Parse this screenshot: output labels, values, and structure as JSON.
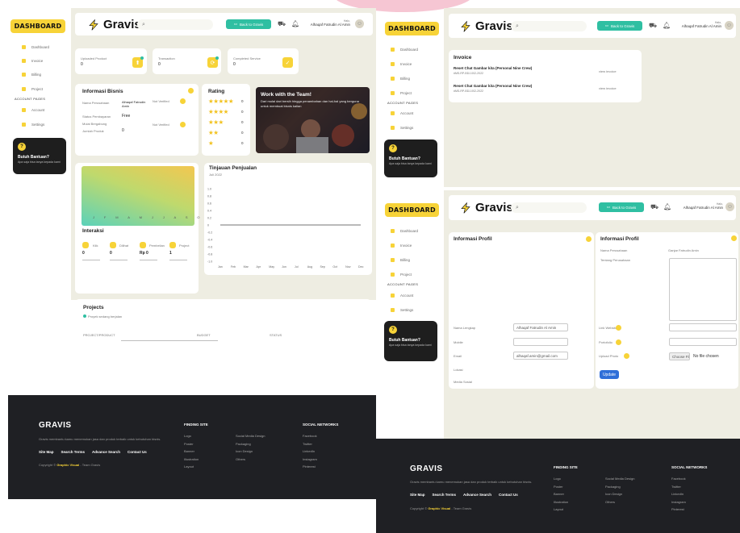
{
  "brand": {
    "sidebar_logo": "DASHBOARD",
    "app_name": "Gravis"
  },
  "colors": {
    "accent_yellow": "#f7d338",
    "accent_teal": "#2fbfa2",
    "panel_bg": "#eeede2",
    "footer_bg": "#1f2024"
  },
  "topbar": {
    "search_icon": "search-icon",
    "back_button": "Back to Gravis",
    "user_small": "Halo,",
    "user_name": "Alhaqaf Fatrudin Al Amin"
  },
  "sidebar": {
    "items": [
      {
        "label": "Dashboard",
        "icon": "home-icon",
        "color": "#f7d338"
      },
      {
        "label": "Invoice",
        "icon": "invoice-icon",
        "color": "#f7d338"
      },
      {
        "label": "Billing",
        "icon": "billing-icon",
        "color": "#f7d338"
      },
      {
        "label": "Project",
        "icon": "project-icon",
        "color": "#f7d338"
      }
    ],
    "section": "ACCOUNT PAGES",
    "account_items": [
      {
        "label": "Account",
        "icon": "user-icon",
        "color": "#f7d338"
      },
      {
        "label": "Settings",
        "icon": "settings-icon",
        "color": "#f7d338"
      }
    ],
    "help_title": "Butuh Bantuan?",
    "help_sub": "Apa saja bisa tanya kepada kami",
    "help_icon": "?"
  },
  "dashboard": {
    "stats": [
      {
        "label": "Uploaded Product",
        "value": "0"
      },
      {
        "label": "Transaction",
        "value": "0"
      },
      {
        "label": "Completed Service",
        "value": "0"
      }
    ],
    "info_title": "Informasi Bisnis",
    "info_rows": [
      {
        "label": "Nama Perusahaan",
        "value": "Alhaqaf Fatrudin Amin"
      },
      {
        "label": "Status Pembayaran",
        "value": "Free"
      },
      {
        "label": "Mulai Bergabung",
        "value": ""
      },
      {
        "label": "Jumlah Produk",
        "value": "0"
      }
    ],
    "info_right": [
      "Not Verified",
      "Not Verified"
    ],
    "rating_title": "Rating",
    "ratings": [
      {
        "stars": "★★★★★",
        "count": "0"
      },
      {
        "stars": "★★★★",
        "count": "0"
      },
      {
        "stars": "★★★",
        "count": "0"
      },
      {
        "stars": "★★",
        "count": "0"
      },
      {
        "stars": "★",
        "count": "0"
      }
    ],
    "team_title": "Work with the Team!",
    "team_text": "Dari mulai dari bersih hingga penambahan dan hal-hal yang berguna untuk membuat bisnis kalian",
    "months": "J F M A M J J A S O N D",
    "interaksi_title": "Interaksi",
    "interaksi": [
      {
        "label": "Klik",
        "value": "0"
      },
      {
        "label": "Dilihat",
        "value": "0"
      },
      {
        "label": "Pembelian",
        "value": "Rp 0"
      },
      {
        "label": "Project",
        "value": "1"
      }
    ],
    "sales_title": "Tinjauan Penjualan",
    "sales_sub": "Juli 2022",
    "projects_title": "Projects",
    "projects_sub": "Proyek sedang berjalan",
    "projects_cols": [
      "PROJECT/PRODUCT",
      "BUDGET",
      "STATUS"
    ]
  },
  "chart_data": {
    "type": "line",
    "title": "Tinjauan Penjualan",
    "categories": [
      "Jan",
      "Feb",
      "Mar",
      "Apr",
      "May",
      "Jun",
      "Jul",
      "Aug",
      "Sep",
      "Oct",
      "Nov",
      "Dec"
    ],
    "series": [
      {
        "values": [
          0,
          0,
          0,
          0,
          0,
          0,
          0,
          0,
          0,
          0,
          0,
          0
        ]
      }
    ],
    "yticks": [
      "1.0",
      "0.8",
      "0.6",
      "0.4",
      "0.2",
      "0",
      "-0.2",
      "-0.4",
      "-0.6",
      "-0.8",
      "-1.0"
    ],
    "ylim": [
      -1,
      1
    ],
    "grid": false
  },
  "invoice": {
    "title": "Invoice",
    "items": [
      {
        "name": "Reset Chat Gambar kita (Personal Nine Crew)",
        "code": "#MS-RP-BDJ-002-2022",
        "action": "view invoice"
      },
      {
        "name": "Reset Chat Gambar kita (Personal Nine Crew)",
        "code": "#MS-RP-BDJ-002-2022",
        "action": "view invoice"
      }
    ]
  },
  "profile": {
    "left_title": "Informasi Profil",
    "right_title": "Informasi Profil",
    "right_name_label": "Nama Perusahaan",
    "right_name_value": "Ganjar Fatrudin Amin",
    "right_about_label": "Tentang Perusahaan",
    "fields": [
      {
        "label": "Nama Lengkap",
        "value": "Alhaqaf Fatrudin Al Amin"
      },
      {
        "label": "Mobile",
        "value": ""
      },
      {
        "label": "Email",
        "value": "alhaqaf.amin@gmail.com"
      },
      {
        "label": "Lokasi",
        "value": ""
      },
      {
        "label": "Media Sosial",
        "value": ""
      }
    ],
    "right_fields": [
      {
        "label": "Link Website",
        "value": ""
      },
      {
        "label": "Portofolio",
        "value": ""
      },
      {
        "label": "Upload Photo",
        "value": ""
      }
    ],
    "choose_file": "Choose File",
    "no_file": "No file chosen",
    "update_button": "Update"
  },
  "footer": {
    "logo": "GRAVIS",
    "tagline": "Gravis membantu kamu menemukan jasa dan produk terbaik untuk kebutuhan bisnis.",
    "links": [
      "Site Map",
      "Search Terms",
      "Advance Search",
      "Contact Us"
    ],
    "copyright_prefix": "Copyright ©",
    "copyright_brand": "Graphic Visual",
    "copyright_suffix": "- Team Gravis",
    "col1_title": "FINDING SITE",
    "col1": [
      "Logo",
      "Poster",
      "Banner",
      "Illustration",
      "Layout"
    ],
    "col2": [
      "Social Media Design",
      "Packaging",
      "Icon Design",
      "Others"
    ],
    "col3_title": "SOCIAL NETWORKS",
    "col3": [
      "Facebook",
      "Twitter",
      "LinkedIn",
      "Instagram",
      "Pinterest"
    ]
  }
}
